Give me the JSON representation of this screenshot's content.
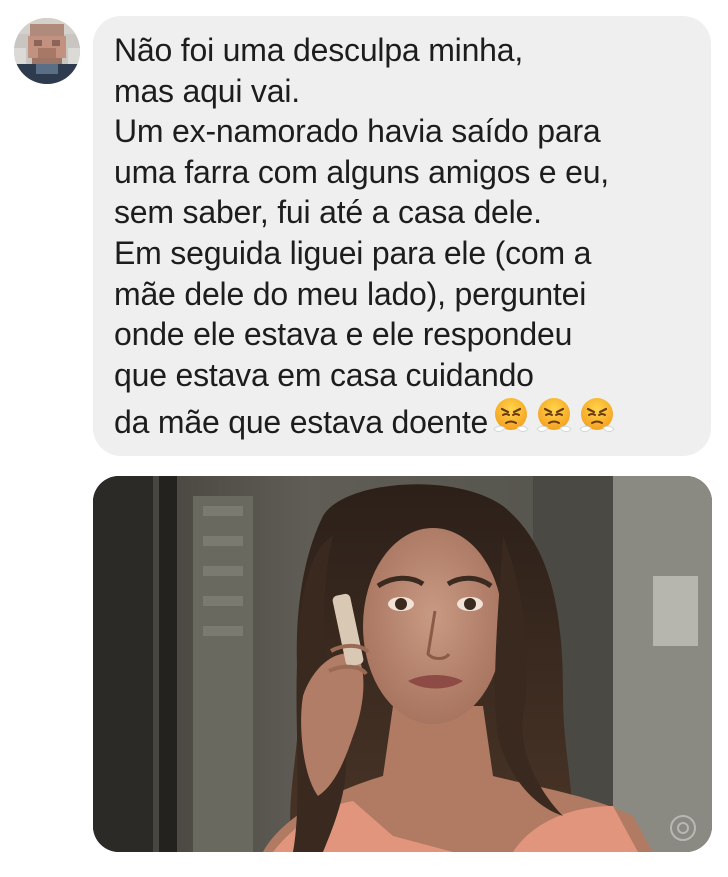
{
  "message": {
    "lines": [
      "Não foi uma desculpa minha,",
      "mas aqui vai.",
      "Um ex-namorado havia saído para",
      "uma farra com alguns amigos e eu,",
      "sem saber, fui até a casa dele.",
      "Em seguida liguei para ele (com a",
      "mãe dele do meu lado), perguntei",
      "onde ele estava e ele respondeu",
      "que estava em casa cuidando",
      "da mãe que estava doente"
    ],
    "emoji_count": 3,
    "emoji_name": "face-with-steam-from-nose",
    "bubble_color": "#efefef",
    "text_color": "#1d1d1d"
  },
  "avatar": {
    "name": "pixelated-profile-photo"
  },
  "attachment": {
    "name": "tv-still-woman-on-phone"
  }
}
